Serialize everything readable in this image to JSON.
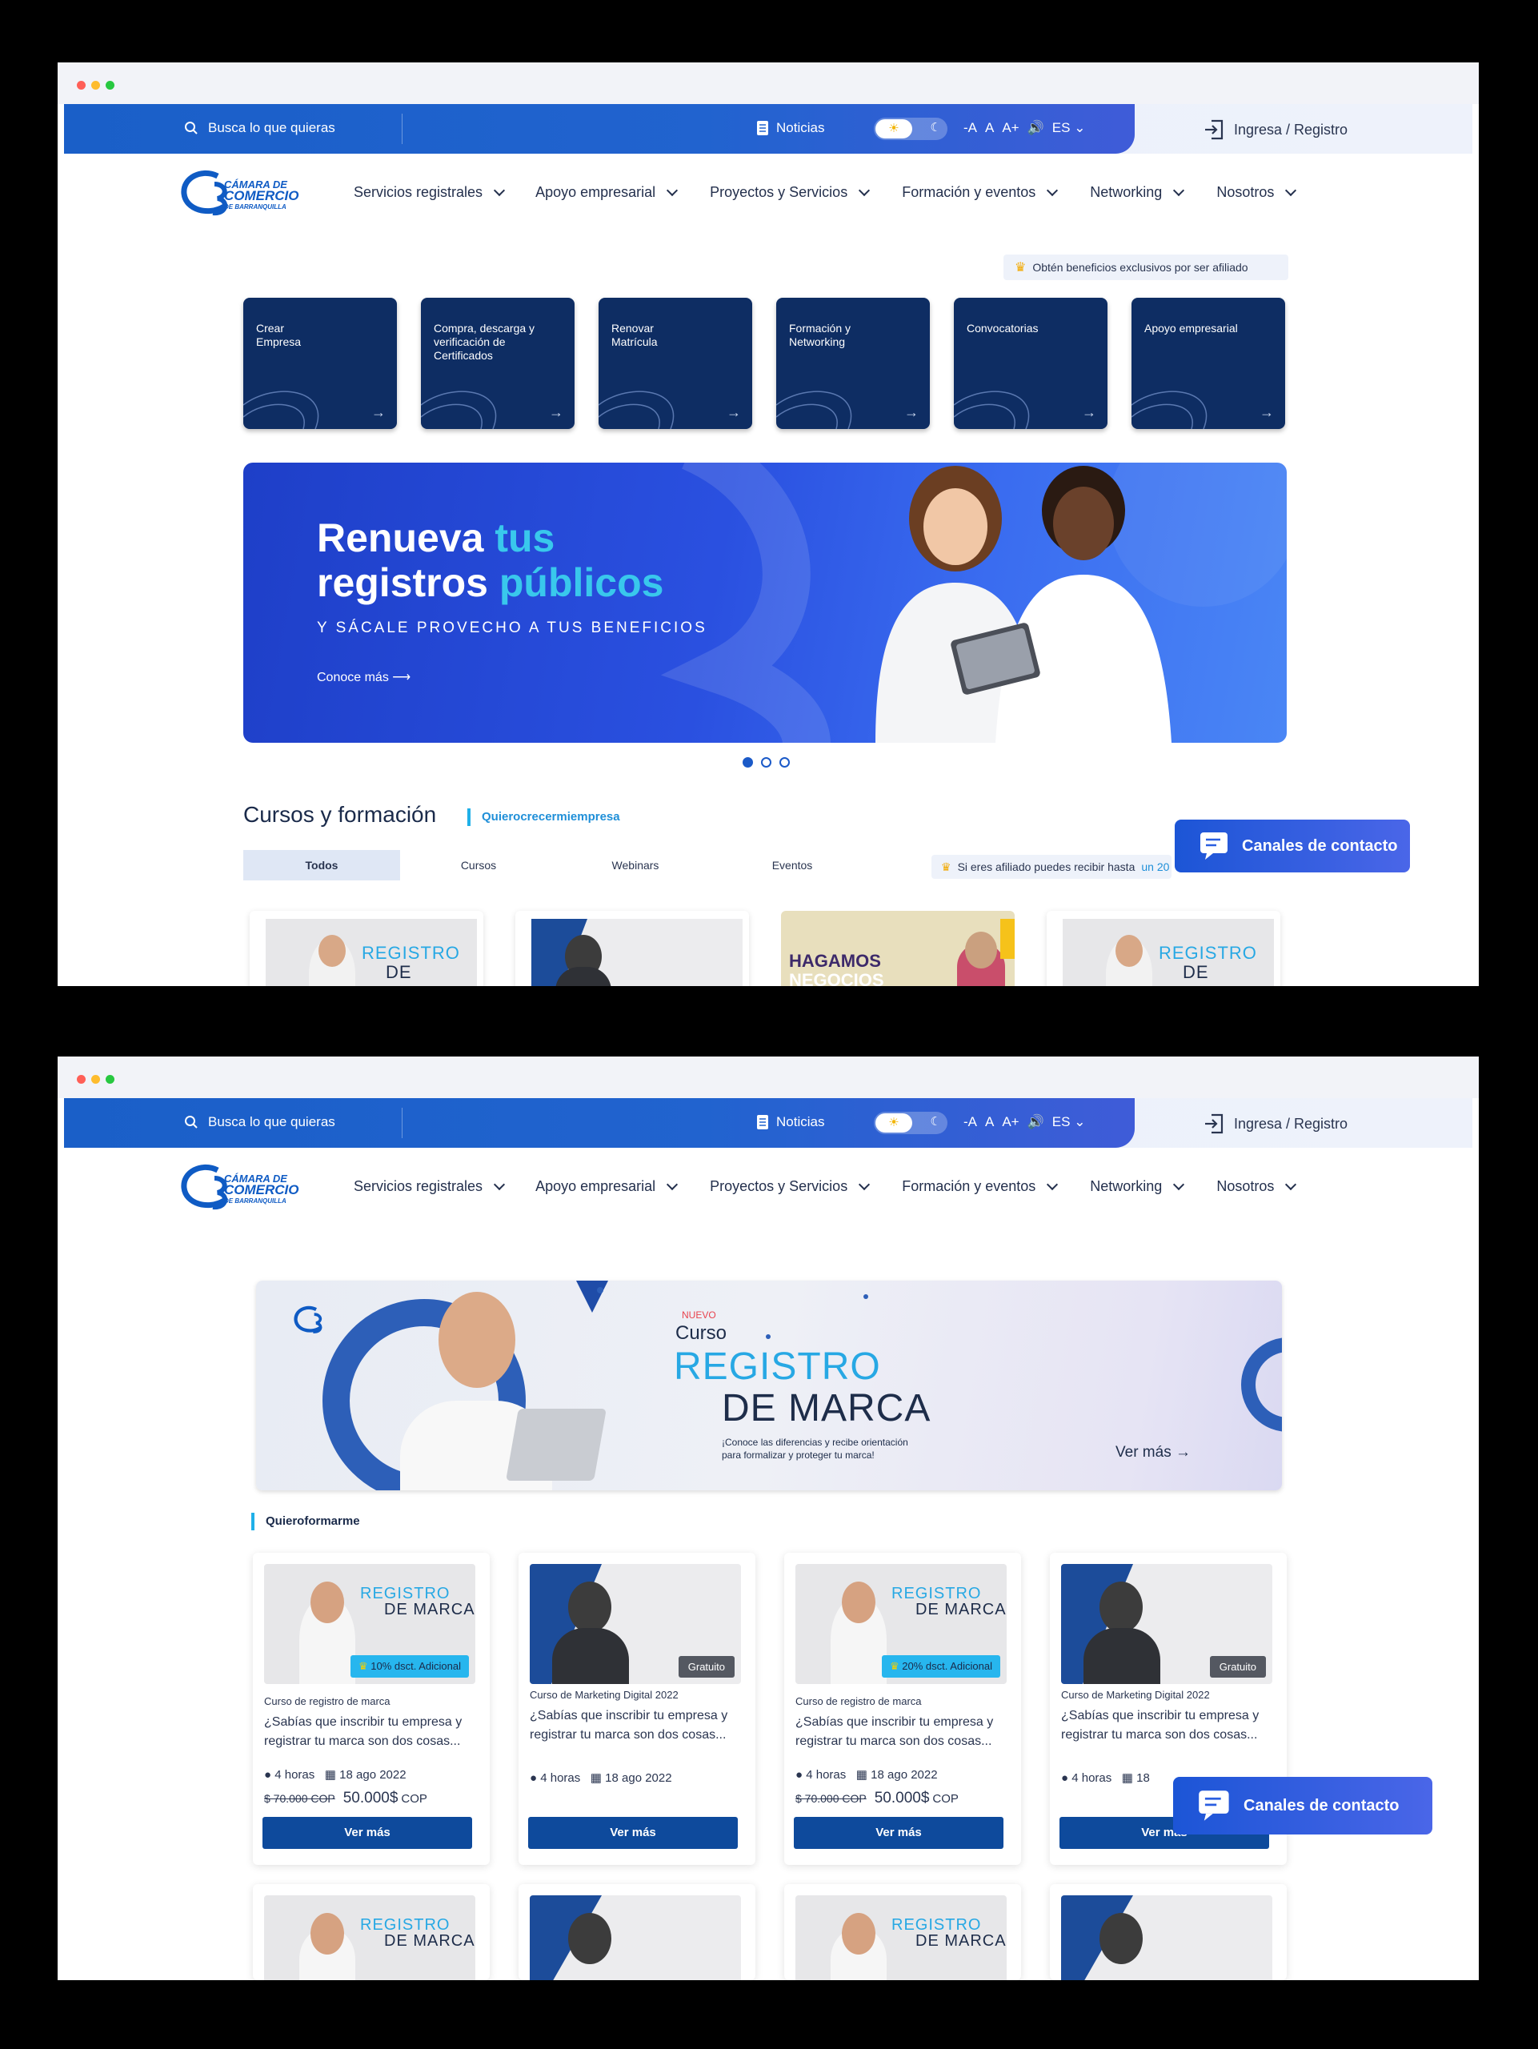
{
  "header": {
    "search_placeholder": "Busca lo que quieras",
    "news": "Noticias",
    "font_small": "-A",
    "font_normal": "A",
    "font_large": "A+",
    "language": "ES",
    "login": "Ingresa / Registro"
  },
  "nav": {
    "logo_line1": "CÁMARA DE",
    "logo_line2": "COMERCIO",
    "logo_line3": "DE BARRANQUILLA",
    "items": [
      {
        "label": "Servicios registrales"
      },
      {
        "label": "Apoyo empresarial"
      },
      {
        "label": "Proyectos y Servicios"
      },
      {
        "label": "Formación y eventos"
      },
      {
        "label": "Networking"
      },
      {
        "label": "Nosotros"
      }
    ]
  },
  "home": {
    "affiliate_notice": "Obtén beneficios exclusivos por ser afiliado",
    "tiles": [
      {
        "label": "Crear\nEmpresa"
      },
      {
        "label": "Compra, descarga y verificación de Certificados"
      },
      {
        "label": "Renovar\nMatrícula"
      },
      {
        "label": "Formación y\nNetworking"
      },
      {
        "label": "Convocatorias"
      },
      {
        "label": "Apoyo empresarial"
      }
    ],
    "hero": {
      "line1_a": "Renue",
      "line1_b": "va ",
      "line1_c": "tus",
      "line2_a": "registros ",
      "line2_b": "públicos",
      "subtitle": "Y SÁCALE PROVECHO A TUS BENEFICIOS",
      "cta": "Conoce más"
    },
    "courses_title": "Cursos y formación",
    "courses_tag": "Quierocrecermiempresa",
    "filter_tabs": [
      "Todos",
      "Cursos",
      "Webinars",
      "Eventos"
    ],
    "affiliate_discount_a": "Si eres afiliado puedes recibir hasta",
    "affiliate_discount_b": "un 20",
    "thumb_registro": "REGISTRO",
    "thumb_marca": "DE MARCA",
    "thumb_hagamos": "HAGAMOS",
    "thumb_negocios": "NEGOCIOS"
  },
  "contact_button": "Canales de contacto",
  "courses_page": {
    "banner": {
      "nuevo": "NUEVO",
      "curso": "Curso",
      "registro": "REGISTRO",
      "marca": "DE MARCA",
      "text": "¡Conoce las diferencias y recibe orientación para formalizar y proteger tu marca!",
      "cta": "Ver más"
    },
    "tag": "Quieroformarme",
    "cards": [
      {
        "badge": "10% dsct. Adicional",
        "category": "Curso de registro de marca",
        "description": "¿Sabías que inscribir tu empresa y registrar tu marca son dos cosas...",
        "hours": "4 horas",
        "date": "18 ago 2022",
        "old_price": "$ 70.000 COP",
        "price": "50.000$",
        "currency": "COP",
        "button": "Ver más"
      },
      {
        "badge": "Gratuito",
        "category": "Curso de Marketing Digital 2022",
        "description": "¿Sabías que inscribir tu empresa y registrar tu marca son dos cosas...",
        "hours": "4 horas",
        "date": "18 ago 2022",
        "button": "Ver más"
      },
      {
        "badge": "20% dsct. Adicional",
        "category": "Curso de registro de marca",
        "description": "¿Sabías que inscribir tu empresa y registrar tu marca son dos cosas...",
        "hours": "4 horas",
        "date": "18 ago 2022",
        "old_price": "$ 70.000 COP",
        "price": "50.000$",
        "currency": "COP",
        "button": "Ver más"
      },
      {
        "badge": "Gratuito",
        "category": "Curso de Marketing Digital 2022",
        "description": "¿Sabías que inscribir tu empresa y registrar tu marca son dos cosas...",
        "hours": "4 horas",
        "date": "18",
        "button": "Ver más"
      }
    ]
  },
  "colors": {
    "primary_blue": "#1a5fc8",
    "dark_navy": "#0e2d63",
    "accent_cyan": "#39c8ec",
    "button_blue": "#0e4a9c"
  }
}
